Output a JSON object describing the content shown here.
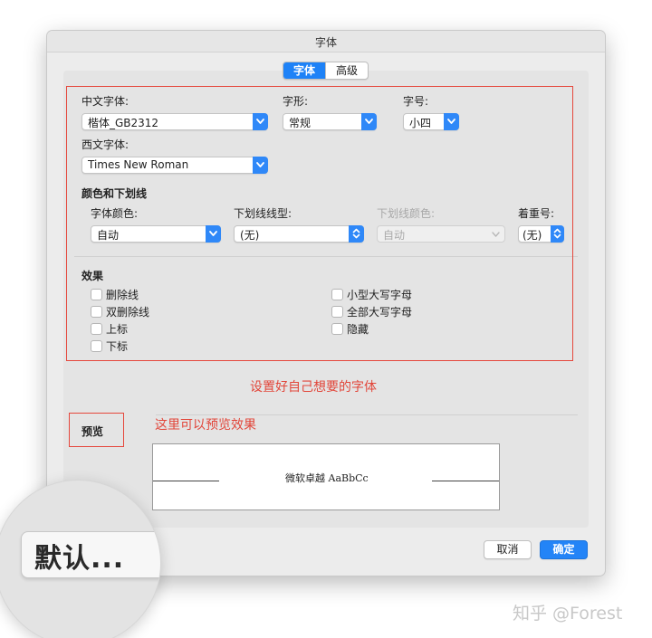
{
  "window": {
    "title": "字体"
  },
  "tabs": [
    {
      "label": "字体",
      "active": true
    },
    {
      "label": "高级",
      "active": false
    }
  ],
  "font": {
    "chinese_label": "中文字体:",
    "chinese_value": "楷体_GB2312",
    "style_label": "字形:",
    "style_value": "常规",
    "size_label": "字号:",
    "size_value": "小四",
    "western_label": "西文字体:",
    "western_value": "Times New Roman"
  },
  "color_underline": {
    "heading": "颜色和下划线",
    "font_color_label": "字体颜色:",
    "font_color_value": "自动",
    "underline_style_label": "下划线线型:",
    "underline_style_value": "(无)",
    "underline_color_label": "下划线颜色:",
    "underline_color_value": "自动",
    "emphasis_label": "着重号:",
    "emphasis_value": "(无)"
  },
  "effects": {
    "heading": "效果",
    "left": [
      "删除线",
      "双删除线",
      "上标",
      "下标"
    ],
    "right": [
      "小型大写字母",
      "全部大写字母",
      "隐藏"
    ]
  },
  "annotations": {
    "set_font": "设置好自己想要的字体",
    "preview_hint": "这里可以预览效果"
  },
  "preview": {
    "label": "预览",
    "sample_text": "微软卓越 AaBbCc"
  },
  "buttons": {
    "default": "默认...",
    "cancel": "取消",
    "ok": "确定"
  },
  "watermark": "知乎 @Forest",
  "colors": {
    "accent": "#1e82f7",
    "annotation_red": "#e2463a"
  }
}
